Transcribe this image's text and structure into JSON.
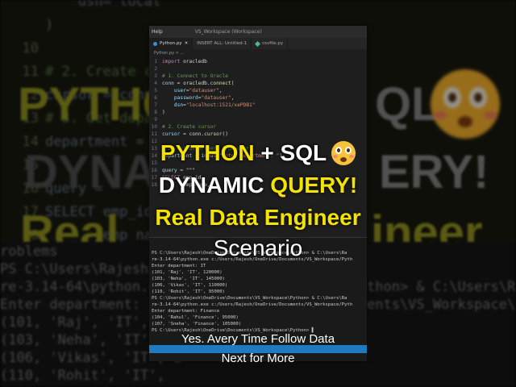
{
  "background": {
    "code_lines": [
      {
        "num": "",
        "text": "    dsn=\"local"
      },
      {
        "num": "",
        "text": ")"
      },
      {
        "num": "10",
        "text": ""
      },
      {
        "num": "11",
        "text": "# 2. Create cu"
      },
      {
        "num": "12",
        "text": "cursor = conn."
      },
      {
        "num": "13",
        "text": "# 3. Get depa"
      },
      {
        "num": "14",
        "text": "department = i"
      },
      {
        "num": "15",
        "text": ""
      },
      {
        "num": "16",
        "text": "query = "
      },
      {
        "num": "17",
        "text": "SELECT emp_id,"
      },
      {
        "num": "18",
        "text": "       emp_nam"
      }
    ],
    "big_left_1": "PYTHON",
    "big_right_1": "QL",
    "big_left_2": "DYNA",
    "big_right_2": "ERY!",
    "big_left_3": "Real",
    "big_right_3": "ineer",
    "term_lines": [
      "roblems",
      "PS C:\\Users\\Rajesh\\On",
      "re-3.14-64\\python.exe",
      "Enter department: IT",
      "(101, 'Raj', 'IT', 120",
      "(103, 'Neha', 'IT',",
      "(106, 'Vikas', 'IT', 1",
      "(110, 'Rohit', 'IT',"
    ],
    "term_right_lines": [
      "thon> & C:\\Users\\Rajes",
      "ents\\VS_Workspace\\Pyth"
    ]
  },
  "window": {
    "menu_help": "Help",
    "title": "VS_Workspace (Workspace)"
  },
  "tabs": [
    {
      "label": "Python.py",
      "close": "✕"
    },
    {
      "label": "INSERT ALL: Untitled-1",
      "close": ""
    },
    {
      "label": "csvfile.py",
      "close": ""
    }
  ],
  "breadcrumb": "Python.py > ...",
  "editor": {
    "lines": [
      {
        "num": "1",
        "parts": [
          [
            "kw",
            "import "
          ],
          [
            "plain",
            "oracledb"
          ]
        ]
      },
      {
        "num": "2",
        "parts": []
      },
      {
        "num": "3",
        "parts": [
          [
            "cm",
            "# 1. Connect to Oracle"
          ]
        ]
      },
      {
        "num": "4",
        "parts": [
          [
            "code",
            "conn "
          ],
          [
            "plain",
            "= oracledb."
          ],
          [
            "fn",
            "connect"
          ],
          [
            "plain",
            "("
          ]
        ]
      },
      {
        "num": "5",
        "parts": [
          [
            "code",
            "    user"
          ],
          [
            "plain",
            "="
          ],
          [
            "str",
            "\"datauser\""
          ],
          [
            "plain",
            ","
          ]
        ]
      },
      {
        "num": "6",
        "parts": [
          [
            "code",
            "    password"
          ],
          [
            "plain",
            "="
          ],
          [
            "str",
            "\"datauser\""
          ],
          [
            "plain",
            ","
          ]
        ]
      },
      {
        "num": "7",
        "parts": [
          [
            "code",
            "    dsn"
          ],
          [
            "plain",
            "="
          ],
          [
            "str",
            "\"localhost:1521/xePDB1\""
          ]
        ]
      },
      {
        "num": "8",
        "parts": [
          [
            "plain",
            ")"
          ]
        ]
      },
      {
        "num": "9",
        "parts": []
      },
      {
        "num": "10",
        "parts": [
          [
            "cm",
            "# 2. Create cursor"
          ]
        ]
      },
      {
        "num": "11",
        "parts": [
          [
            "code",
            "cursor "
          ],
          [
            "plain",
            "= conn."
          ],
          [
            "fn",
            "cursor"
          ],
          [
            "plain",
            "()"
          ]
        ]
      },
      {
        "num": "12",
        "parts": []
      },
      {
        "num": "13",
        "parts": [
          [
            "cm",
            "# 3. Get department from user"
          ]
        ]
      },
      {
        "num": "14",
        "parts": [
          [
            "code",
            "department "
          ],
          [
            "plain",
            "= "
          ],
          [
            "fn",
            "input"
          ],
          [
            "plain",
            "("
          ],
          [
            "str",
            "\"Enter department: \""
          ],
          [
            "plain",
            ")"
          ]
        ]
      },
      {
        "num": "15",
        "parts": []
      },
      {
        "num": "16",
        "parts": [
          [
            "code",
            "query "
          ],
          [
            "plain",
            "= \"\"\""
          ]
        ]
      },
      {
        "num": "17",
        "parts": [
          [
            "kw",
            "SELECT "
          ],
          [
            "plain",
            "emp_id,"
          ]
        ]
      },
      {
        "num": "18",
        "parts": [
          [
            "plain",
            "       emp_name,"
          ]
        ]
      }
    ]
  },
  "terminal": {
    "lines": [
      "PS C:\\Users\\Rajesh\\OneDrive\\Documents\\VS_Workspace\\Python> & C:\\Users\\Ra",
      "re-3.14-64\\python.exe c:/Users/Rajesh/OneDrive/Documents/VS_Workspace/Pyth",
      "Enter department: IT",
      "(101, 'Raj', 'IT', 120000)",
      "(103, 'Neha', 'IT', 145000)",
      "(106, 'Vikas', 'IT', 110000)",
      "(110, 'Rohit', 'IT', 95000)",
      "PS C:\\Users\\Rajesh\\OneDrive\\Documents\\VS_Workspace\\Python> & C:\\Users\\Ra",
      "re-3.14-64\\python.exe c:/Users/Rajesh/OneDrive/Documents/VS_Workspace/Pyth",
      "Enter department: Finance",
      "(104, 'Rahul', 'Finance', 95000)",
      "(107, 'Sneha', 'Finance', 105000)",
      "PS C:\\Users\\Rajesh\\OneDrive\\Documents\\VS_Workspace\\Python> ▌"
    ]
  },
  "headline": {
    "line1_a": "PYTHON",
    "line1_b": " + SQL",
    "line2_a": "DYNAMIC ",
    "line2_b": "QUERY!",
    "line3": "Real Data Engineer",
    "line4": "Scenario"
  },
  "caption": {
    "line1": "Yes. Avery Time Follow Data",
    "line2": "Next for More"
  },
  "colors": {
    "accent_yellow": "#f4e300",
    "status_blue": "#1f7bbf",
    "editor_bg": "#1e1e1e"
  },
  "icons": [
    "python-file-icon",
    "csv-file-icon",
    "flushed-face-emoji-icon",
    "close-icon"
  ]
}
